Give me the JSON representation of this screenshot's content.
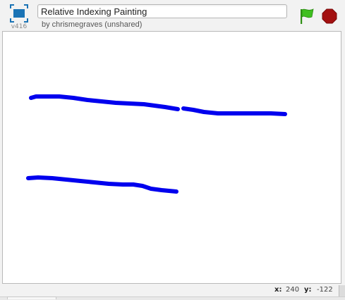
{
  "header": {
    "version": "v416",
    "title": "Relative Indexing Painting",
    "byline": "by chrismegraves (unshared)"
  },
  "icons": {
    "present": "fullscreen-presentation-icon",
    "flag": "green-flag-icon",
    "stop": "stop-sign-icon"
  },
  "colors": {
    "pen": "#0000ee",
    "flag": "#3fbf1f",
    "stop": "#a31010",
    "present": "#1a73b5"
  },
  "coords": {
    "x_label": "x:",
    "x_value": "240",
    "y_label": "y:",
    "y_value": "-122"
  }
}
